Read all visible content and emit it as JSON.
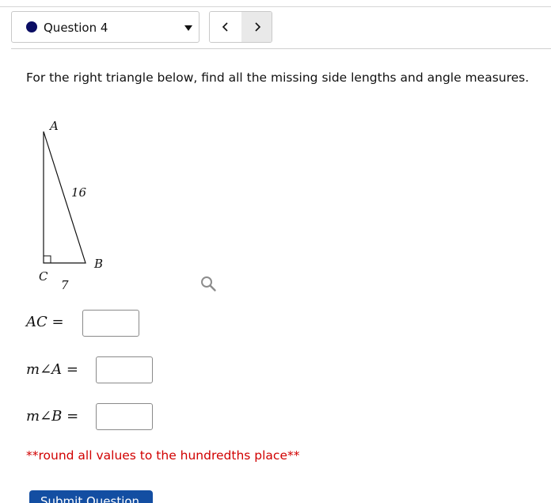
{
  "header": {
    "question_label": "Question 4",
    "prev_label": "<",
    "next_label": ">"
  },
  "problem": {
    "prompt": "For the right triangle below, find all the missing side lengths and angle measures.",
    "figure": {
      "vertex_a": "A",
      "vertex_b": "B",
      "vertex_c": "C",
      "hypotenuse": "16",
      "leg_bc": "7"
    }
  },
  "answers": {
    "ac": {
      "lhs": "AC",
      "value": ""
    },
    "angle_a": {
      "lhs_m": "m",
      "lhs_angle": "∠",
      "lhs_v": "A",
      "value": ""
    },
    "angle_b": {
      "lhs_m": "m",
      "lhs_angle": "∠",
      "lhs_v": "B",
      "value": ""
    },
    "equals": "="
  },
  "note": "**round all values to the hundredths place**",
  "submit_label": "Submit Question",
  "colors": {
    "navy": "#0a0d63",
    "red": "#d10000",
    "submit_blue": "#134ea2"
  }
}
